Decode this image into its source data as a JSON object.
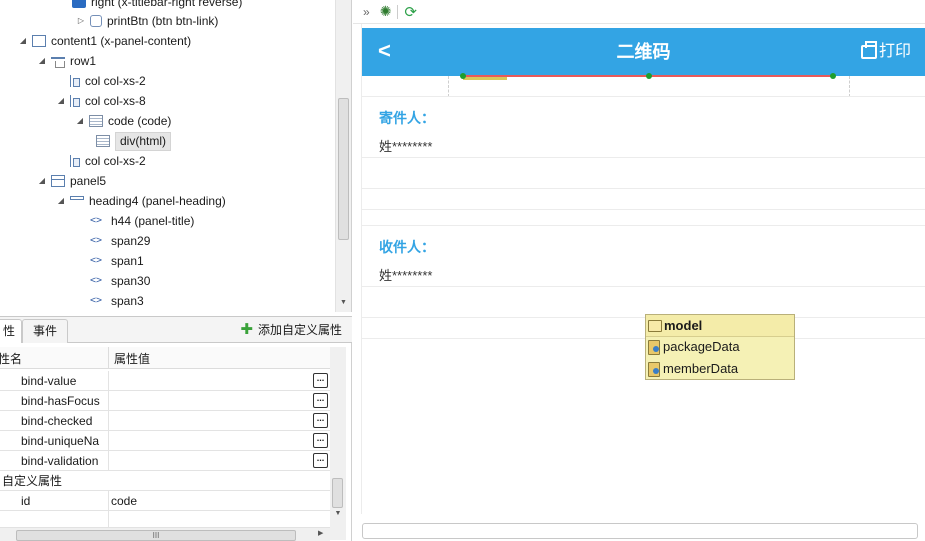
{
  "tree": {
    "nodes": [
      {
        "toggle": "▲",
        "icon": "blue",
        "label": "right (x-titlebar-right reverse)"
      },
      {
        "toggle": "▷",
        "icon": "btnlink",
        "label": "printBtn (btn btn-link)"
      },
      {
        "toggle": "◢",
        "icon": "panel",
        "label": "content1 (x-panel-content)"
      },
      {
        "toggle": "◢",
        "icon": "rowi",
        "label": "row1"
      },
      {
        "toggle": "",
        "icon": "col",
        "label": "col col-xs-2"
      },
      {
        "toggle": "◢",
        "icon": "col",
        "label": "col col-xs-8"
      },
      {
        "toggle": "◢",
        "icon": "code",
        "label": "code (code)"
      },
      {
        "toggle": "",
        "icon": "code",
        "label": "div(html)",
        "selected": true
      },
      {
        "toggle": "",
        "icon": "col",
        "label": "col col-xs-2"
      },
      {
        "toggle": "◢",
        "icon": "panelx",
        "label": "panel5"
      },
      {
        "toggle": "◢",
        "icon": "heading",
        "label": "heading4 (panel-heading)"
      },
      {
        "toggle": "",
        "icon": "tag",
        "label": "h44 (panel-title)"
      },
      {
        "toggle": "",
        "icon": "tag",
        "label": "span29"
      },
      {
        "toggle": "",
        "icon": "tag",
        "label": "span1"
      },
      {
        "toggle": "",
        "icon": "tag",
        "label": "span30"
      },
      {
        "toggle": "",
        "icon": "tag",
        "label": "span3"
      }
    ]
  },
  "props": {
    "tab_attr": "性",
    "tab_events": "事件",
    "add_custom": "添加自定义属性",
    "col_name": "性名",
    "col_value": "属性值",
    "rows": [
      {
        "key": "bind-value",
        "value": "",
        "dots": true
      },
      {
        "key": "bind-hasFocus",
        "value": "",
        "dots": true
      },
      {
        "key": "bind-checked",
        "value": "",
        "dots": true
      },
      {
        "key": "bind-uniqueNa",
        "value": "",
        "dots": true
      },
      {
        "key": "bind-validation",
        "value": "",
        "dots": true
      }
    ],
    "group_custom": "自定义属性",
    "custom_rows": [
      {
        "key": "id",
        "value": "code"
      }
    ],
    "hscroll_glyph": "III"
  },
  "canvas": {
    "toolbar_expand": "»",
    "title": "二维码",
    "back": "<",
    "print": "打印",
    "sender_label": "寄件人：",
    "sender_value": "姓********",
    "receiver_label": "收件人：",
    "receiver_value": "姓********"
  },
  "model": {
    "name": "model",
    "items": [
      "packageData",
      "memberData"
    ]
  }
}
